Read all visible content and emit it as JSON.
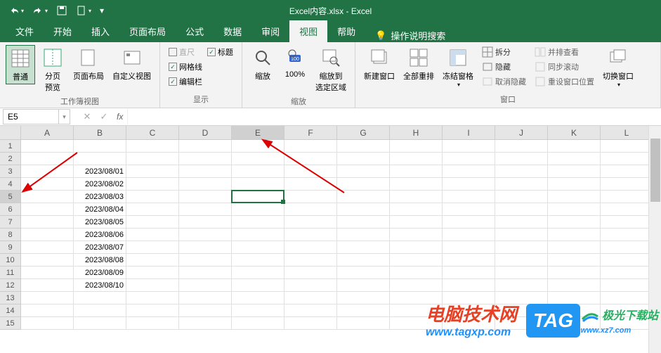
{
  "title": "Excel内容.xlsx  -  Excel",
  "tabs": [
    "文件",
    "开始",
    "插入",
    "页面布局",
    "公式",
    "数据",
    "审阅",
    "视图",
    "帮助"
  ],
  "active_tab": "视图",
  "tell_me": "操作说明搜索",
  "ribbon": {
    "views": {
      "normal": "普通",
      "pagebreak": "分页\n预览",
      "pagelayout": "页面布局",
      "custom": "自定义视图",
      "label": "工作簿视图"
    },
    "show": {
      "ruler": "直尺",
      "headings": "标题",
      "gridlines": "网格线",
      "formulabar": "编辑栏",
      "label": "显示"
    },
    "zoom": {
      "zoom": "缩放",
      "hundred": "100%",
      "selection": "缩放到\n选定区域",
      "label": "缩放"
    },
    "window": {
      "newwin": "新建窗口",
      "arrange": "全部重排",
      "freeze": "冻结窗格",
      "split": "拆分",
      "hide": "隐藏",
      "unhide": "取消隐藏",
      "sidebyside": "并排查看",
      "syncscroll": "同步滚动",
      "resetpos": "重设窗口位置",
      "switch": "切换窗口",
      "label": "窗口"
    }
  },
  "namebox": "E5",
  "columns": [
    "A",
    "B",
    "C",
    "D",
    "E",
    "F",
    "G",
    "H",
    "I",
    "J",
    "K",
    "L"
  ],
  "rows_count": 15,
  "active": {
    "row": 5,
    "col": "E"
  },
  "data": {
    "3": {
      "B": "2023/08/01"
    },
    "4": {
      "B": "2023/08/02"
    },
    "5": {
      "B": "2023/08/03"
    },
    "6": {
      "B": "2023/08/04"
    },
    "7": {
      "B": "2023/08/05"
    },
    "8": {
      "B": "2023/08/06"
    },
    "9": {
      "B": "2023/08/07"
    },
    "10": {
      "B": "2023/08/08"
    },
    "11": {
      "B": "2023/08/09"
    },
    "12": {
      "B": "2023/08/10"
    }
  },
  "watermark": {
    "red": "电脑技术网",
    "blue": "www.tagxp.com",
    "tag": "TAG",
    "jg": "极光下载站",
    "jg_url": "www.xz7.com"
  }
}
